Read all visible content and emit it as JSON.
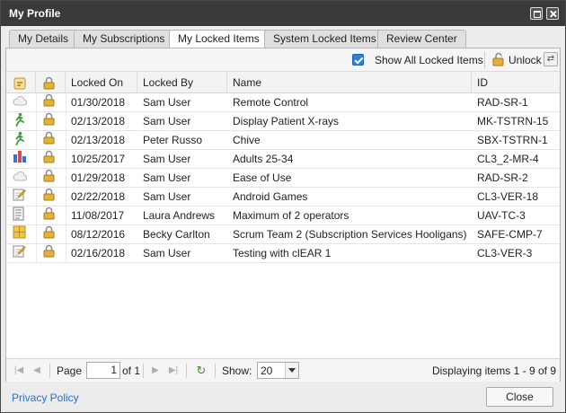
{
  "window": {
    "title": "My Profile"
  },
  "tabs": [
    {
      "label": "My Details",
      "active": false
    },
    {
      "label": "My Subscriptions",
      "active": false
    },
    {
      "label": "My Locked Items",
      "active": true
    },
    {
      "label": "System Locked Items",
      "active": false
    },
    {
      "label": "Review Center",
      "active": false
    }
  ],
  "toolbar": {
    "show_all_label": "Show All Locked Items",
    "show_all_checked": true,
    "unlock_label": "Unlock"
  },
  "grid": {
    "columns": [
      "",
      "",
      "Locked On",
      "Locked By",
      "Name",
      "ID"
    ],
    "rows": [
      {
        "type_icon": "cloud-icon",
        "locked_on": "01/30/2018",
        "locked_by": "Sam User",
        "name": "Remote Control",
        "id": "RAD-SR-1"
      },
      {
        "type_icon": "runner-icon",
        "locked_on": "02/13/2018",
        "locked_by": "Sam User",
        "name": "Display Patient X-rays",
        "id": "MK-TSTRN-15"
      },
      {
        "type_icon": "runner-icon",
        "locked_on": "02/13/2018",
        "locked_by": "Peter Russo",
        "name": "Chive",
        "id": "SBX-TSTRN-1"
      },
      {
        "type_icon": "bar-chart-icon",
        "locked_on": "10/25/2017",
        "locked_by": "Sam User",
        "name": "Adults 25-34",
        "id": "CL3_2-MR-4"
      },
      {
        "type_icon": "cloud-icon",
        "locked_on": "01/29/2018",
        "locked_by": "Sam User",
        "name": "Ease of Use",
        "id": "RAD-SR-2"
      },
      {
        "type_icon": "note-edit-icon",
        "locked_on": "02/22/2018",
        "locked_by": "Sam User",
        "name": "Android Games",
        "id": "CL3-VER-18"
      },
      {
        "type_icon": "document-list-icon",
        "locked_on": "11/08/2017",
        "locked_by": "Laura Andrews",
        "name": "Maximum of 2 operators",
        "id": "UAV-TC-3"
      },
      {
        "type_icon": "grid-icon",
        "locked_on": "08/12/2016",
        "locked_by": "Becky Carlton",
        "name": "Scrum Team 2 (Subscription Services Hooligans)",
        "id": "SAFE-CMP-7"
      },
      {
        "type_icon": "note-edit-icon",
        "locked_on": "02/16/2018",
        "locked_by": "Sam User",
        "name": "Testing with clEAR 1",
        "id": "CL3-VER-3"
      }
    ]
  },
  "pager": {
    "page_label": "Page",
    "page_value": "1",
    "of_label": "of 1",
    "show_label": "Show:",
    "show_value": "20",
    "display_info": "Displaying items 1 - 9 of 9"
  },
  "footer": {
    "privacy_label": "Privacy Policy",
    "close_label": "Close"
  },
  "colors": {
    "titlebar": "#3a3a3a",
    "accent": "#2f7fd6",
    "link": "#2a6fc9",
    "lock": "#e2b23a"
  }
}
